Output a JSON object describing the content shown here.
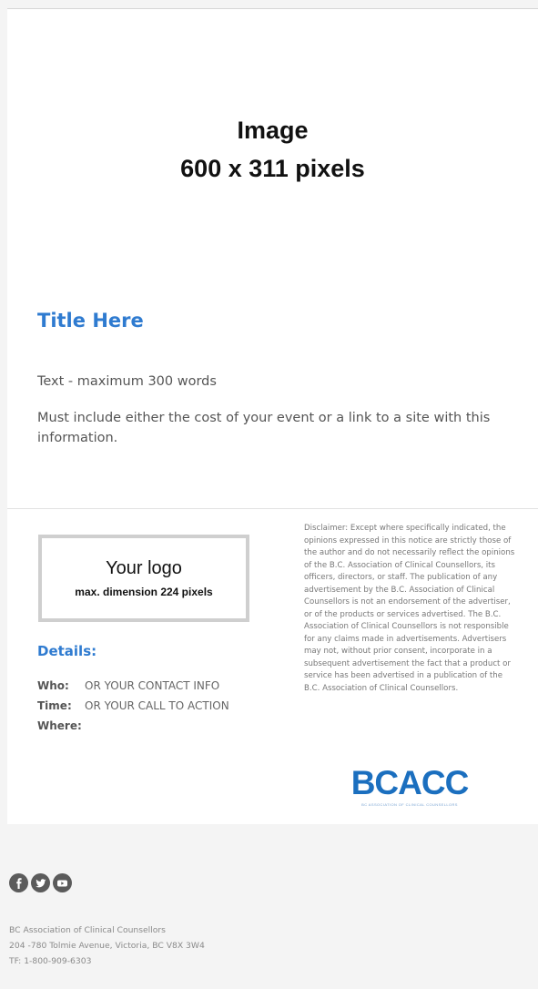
{
  "hero": {
    "line1": "Image",
    "line2": "600 x 311 pixels"
  },
  "article": {
    "title": "Title Here",
    "paragraphs": [
      "Text - maximum 300 words",
      "Must include either the cost of your event or a link to a site with this information."
    ]
  },
  "logo_placeholder": {
    "main": "Your logo",
    "sub": "max. dimension 224 pixels"
  },
  "details": {
    "title": "Details:",
    "rows": [
      {
        "label": "Who:",
        "value": "OR YOUR CONTACT INFO"
      },
      {
        "label": "Time:",
        "value": "OR YOUR CALL TO ACTION"
      },
      {
        "label": "Where:",
        "value": ""
      }
    ]
  },
  "disclaimer": "Disclaimer: Except where specifically indicated, the opinions expressed in this notice are strictly those of the author and do not necessarily reflect the opinions of the B.C. Association of Clinical Counsellors, its officers, directors, or staff. The publication of any advertisement by the B.C. Association of Clinical Counsellors is not an endorsement of the advertiser, or of the products or services advertised. The B.C. Association of Clinical Counsellors is not responsible for any claims made in advertisements. Advertisers may not, without prior consent, incorporate in a subsequent advertisement the fact that a product or service has been advertised in a publication of the B.C. Association of Clinical Counsellors.",
  "brand": {
    "wordmark": "BCACC",
    "tagline": "BC ASSOCIATION OF CLINICAL COUNSELLORS",
    "color": "#1b6fbf"
  },
  "footer": {
    "social_icons": [
      "facebook-icon",
      "twitter-icon",
      "youtube-icon"
    ],
    "address_lines": [
      "BC Association of Clinical Counsellors",
      "204 -780 Tolmie Avenue, Victoria, BC V8X 3W4",
      "TF: 1-800-909-6303"
    ]
  },
  "colors": {
    "accent": "#2f7bd0",
    "background": "#f4f4f4",
    "card": "#ffffff"
  }
}
